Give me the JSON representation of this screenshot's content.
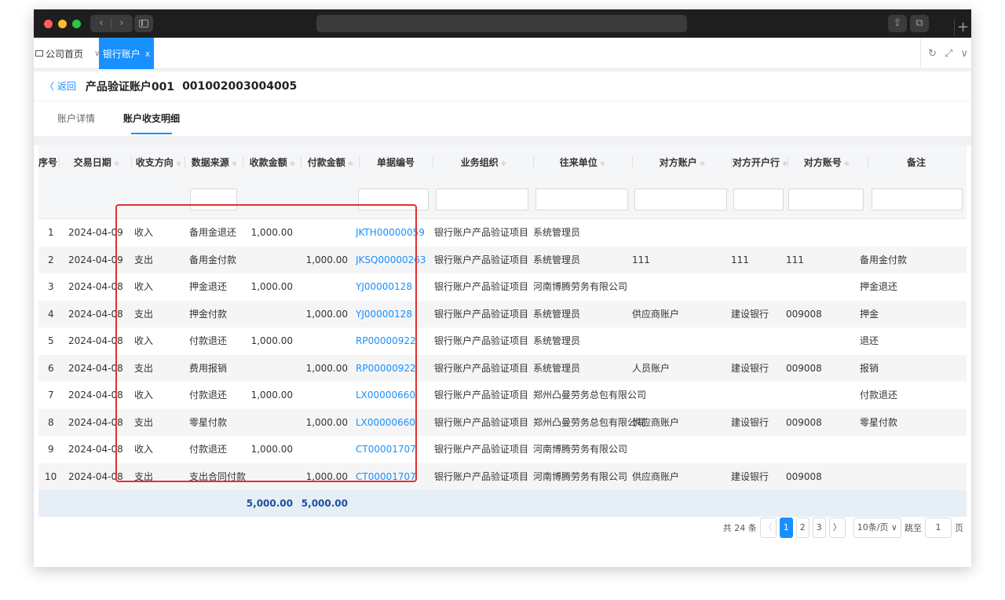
{
  "app_tabs": {
    "home_label": "公司首页",
    "active_label": "银行账户",
    "active_close": "x"
  },
  "header": {
    "back_label": "〈 返回",
    "account_name": "产品验证账户001",
    "account_number": "001002003004005"
  },
  "sub_tabs": [
    {
      "label": "账户详情"
    },
    {
      "label": "账户收支明细"
    }
  ],
  "table": {
    "columns": [
      {
        "label": "序号"
      },
      {
        "label": "交易日期"
      },
      {
        "label": "收支方向"
      },
      {
        "label": "数据来源"
      },
      {
        "label": "收款金额"
      },
      {
        "label": "付款金额"
      },
      {
        "label": "单据编号"
      },
      {
        "label": "业务组织"
      },
      {
        "label": "往来单位"
      },
      {
        "label": "对方账户"
      },
      {
        "label": "对方开户行"
      },
      {
        "label": "对方账号"
      },
      {
        "label": "备注"
      }
    ],
    "rows": [
      {
        "no": "1",
        "date": "2024-04-09",
        "direction": "收入",
        "source": "备用金退还",
        "receipt": "1,000.00",
        "payment": "",
        "doc": "JKTH00000059",
        "org": "银行账户产品验证项目",
        "partner": "系统管理员",
        "cp_account": "",
        "cp_bank": "",
        "cp_number": "",
        "remark": ""
      },
      {
        "no": "2",
        "date": "2024-04-09",
        "direction": "支出",
        "source": "备用金付款",
        "receipt": "",
        "payment": "1,000.00",
        "doc": "JKSQ00000263",
        "org": "银行账户产品验证项目",
        "partner": "系统管理员",
        "cp_account": "111",
        "cp_bank": "111",
        "cp_number": "111",
        "remark": "备用金付款"
      },
      {
        "no": "3",
        "date": "2024-04-08",
        "direction": "收入",
        "source": "押金退还",
        "receipt": "1,000.00",
        "payment": "",
        "doc": "YJ00000128",
        "org": "银行账户产品验证项目",
        "partner": "河南博腾劳务有限公司",
        "cp_account": "",
        "cp_bank": "",
        "cp_number": "",
        "remark": "押金退还"
      },
      {
        "no": "4",
        "date": "2024-04-08",
        "direction": "支出",
        "source": "押金付款",
        "receipt": "",
        "payment": "1,000.00",
        "doc": "YJ00000128",
        "org": "银行账户产品验证项目",
        "partner": "系统管理员",
        "cp_account": "供应商账户",
        "cp_bank": "建设银行",
        "cp_number": "009008",
        "remark": "押金"
      },
      {
        "no": "5",
        "date": "2024-04-08",
        "direction": "收入",
        "source": "付款退还",
        "receipt": "1,000.00",
        "payment": "",
        "doc": "RP00000922",
        "org": "银行账户产品验证项目",
        "partner": "系统管理员",
        "cp_account": "",
        "cp_bank": "",
        "cp_number": "",
        "remark": "退还"
      },
      {
        "no": "6",
        "date": "2024-04-08",
        "direction": "支出",
        "source": "费用报销",
        "receipt": "",
        "payment": "1,000.00",
        "doc": "RP00000922",
        "org": "银行账户产品验证项目",
        "partner": "系统管理员",
        "cp_account": "人员账户",
        "cp_bank": "建设银行",
        "cp_number": "009008",
        "remark": "报销"
      },
      {
        "no": "7",
        "date": "2024-04-08",
        "direction": "收入",
        "source": "付款退还",
        "receipt": "1,000.00",
        "payment": "",
        "doc": "LX00000660",
        "org": "银行账户产品验证项目",
        "partner": "郑州凸曼劳务总包有限公司",
        "cp_account": "",
        "cp_bank": "",
        "cp_number": "",
        "remark": "付款退还"
      },
      {
        "no": "8",
        "date": "2024-04-08",
        "direction": "支出",
        "source": "零星付款",
        "receipt": "",
        "payment": "1,000.00",
        "doc": "LX00000660",
        "org": "银行账户产品验证项目",
        "partner": "郑州凸曼劳务总包有限公司",
        "cp_account": "供应商账户",
        "cp_bank": "建设银行",
        "cp_number": "009008",
        "remark": "零星付款"
      },
      {
        "no": "9",
        "date": "2024-04-08",
        "direction": "收入",
        "source": "付款退还",
        "receipt": "1,000.00",
        "payment": "",
        "doc": "CT00001707",
        "org": "银行账户产品验证项目",
        "partner": "河南博腾劳务有限公司",
        "cp_account": "",
        "cp_bank": "",
        "cp_number": "",
        "remark": ""
      },
      {
        "no": "10",
        "date": "2024-04-08",
        "direction": "支出",
        "source": "支出合同付款",
        "receipt": "",
        "payment": "1,000.00",
        "doc": "CT00001707",
        "org": "银行账户产品验证项目",
        "partner": "河南博腾劳务有限公司",
        "cp_account": "供应商账户",
        "cp_bank": "建设银行",
        "cp_number": "009008",
        "remark": ""
      }
    ],
    "totals": {
      "receipt": "5,000.00",
      "payment": "5,000.00"
    }
  },
  "pagination": {
    "total_text": "共 24 条",
    "prev": "〈",
    "next": "〉",
    "pages": [
      "1",
      "2",
      "3"
    ],
    "current_page": "1",
    "page_size": "10条/页 ∨",
    "goto_label": "跳至",
    "goto_value": "1",
    "page_suffix": "页"
  },
  "icons": {
    "sort": "sort-caret-icon",
    "refresh": "refresh-icon",
    "fullscreen": "fullscreen-icon",
    "dropdown": "chevron-down-icon"
  },
  "colors": {
    "primary": "#1890ff",
    "highlight_border": "#e03131",
    "total_row_bg": "#e6eef6"
  }
}
